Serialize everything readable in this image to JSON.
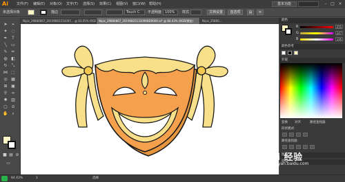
{
  "app": {
    "logo": "Ai",
    "workspace": "基本功能"
  },
  "menu": [
    "文件(F)",
    "编辑(E)",
    "对象(O)",
    "文字(T)",
    "选择(S)",
    "效果(C)",
    "视图(V)",
    "窗口(W)",
    "帮助(H)"
  ],
  "control": {
    "selection_label": "未选择对象",
    "stroke_label": "描边",
    "brush_label": "Touch C",
    "opacity_label": "不透明度",
    "opacity_value": "100%",
    "style_label": "样式",
    "doc_setup": "文档设置",
    "prefs": "首选项"
  },
  "tabs": [
    {
      "label": "Nipic_29884867_20190801154397... @ 83.05% (RGB/预览)",
      "active": false
    },
    {
      "label": "Nipic_29884867_20190825131096BD0000.ai* @ 84.43% (RGB/预览)",
      "active": true
    },
    {
      "label": "Nipic_25860...",
      "active": false
    }
  ],
  "panels": {
    "color_header": "颜色",
    "color_guide": "颜色参考",
    "rgb": [
      {
        "ch": "R",
        "value": "255",
        "color": "#e04040"
      },
      {
        "ch": "G",
        "value": "247",
        "color": "#40c040"
      },
      {
        "ch": "B",
        "value": "195",
        "color": "#4060e0"
      }
    ],
    "swatch": "#fff7c3",
    "appearance_header": "外观",
    "layers_header": "图层",
    "symbols_header": "符号",
    "panel_labels": [
      "变换",
      "对齐",
      "路径查找器",
      "形状模式:",
      "路径查找器:"
    ]
  },
  "status": {
    "zoom": "84.43%",
    "page": "1",
    "tool": "选择"
  },
  "watermark": {
    "brand": "Bai 经验",
    "url": "jingyan.baidu.com"
  },
  "colors": {
    "mask_fill": "#f4a04c",
    "mask_dark": "#e6963e",
    "ribbon": "#f8e08a",
    "ribbon_edge": "#f4c850",
    "outline": "#1a1a1a",
    "mouth_inner": "#ffffff"
  }
}
